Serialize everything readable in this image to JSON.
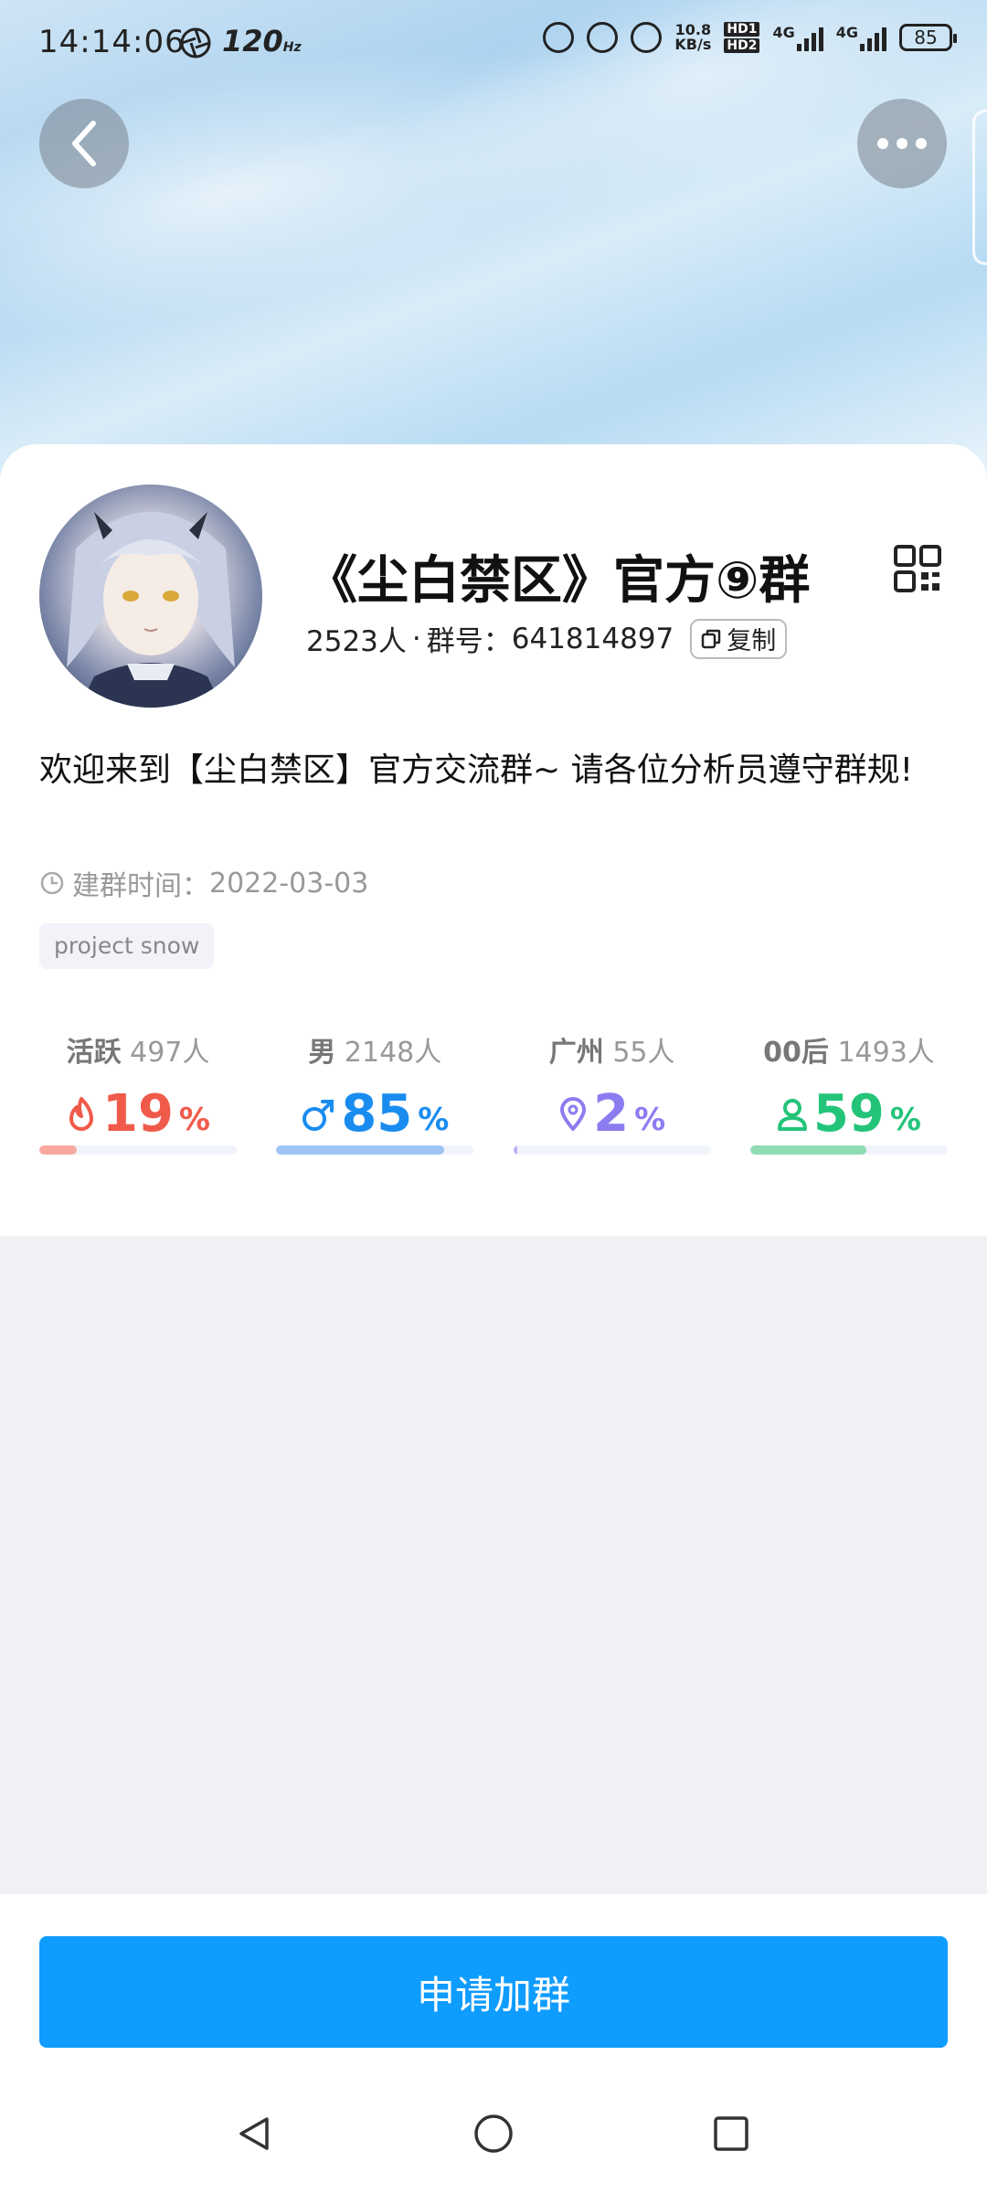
{
  "status_bar": {
    "time": "14:14:06",
    "refresh_rate": "120",
    "network_speed_value": "10.8",
    "network_speed_unit": "KB/s",
    "hd1": "HD1",
    "hd2": "HD2",
    "net1": "4G",
    "net2": "4G",
    "battery": "85"
  },
  "group": {
    "title": "《尘白禁区》官方⑨群",
    "members": "2523人",
    "separator": "·",
    "id_label": "群号：",
    "id": "641814897",
    "copy_label": "复制",
    "description": "欢迎来到【尘白禁区】官方交流群~ 请各位分析员遵守群规!",
    "created_label": "建群时间：",
    "created_date": "2022-03-03",
    "tag": "project snow"
  },
  "stats": [
    {
      "label": "活跃",
      "count": "497人",
      "percent": "19",
      "unit": "%",
      "fill": 0.19,
      "color": "#f05a4a",
      "bar_color": "#f7a99f"
    },
    {
      "label": "男",
      "count": "2148人",
      "percent": "85",
      "unit": "%",
      "fill": 0.85,
      "color": "#1a8cf0",
      "bar_color": "#9ec4f5"
    },
    {
      "label": "广州",
      "count": "55人",
      "percent": "2",
      "unit": "%",
      "fill": 0.02,
      "color": "#8b7cf0",
      "bar_color": "#b9b0f5"
    },
    {
      "label": "00后",
      "count": "1493人",
      "percent": "59",
      "unit": "%",
      "fill": 0.59,
      "color": "#23c47a",
      "bar_color": "#8fdcb5"
    }
  ],
  "icons": {
    "back": "chevron-left-icon",
    "more": "more-horizontal-icon",
    "qr": "qr-code-icon",
    "copy": "copy-icon",
    "clock": "clock-icon",
    "flame": "flame-icon",
    "male": "male-icon",
    "location": "location-pin-icon",
    "person": "person-icon"
  },
  "actions": {
    "join_label": "申请加群"
  },
  "colors": {
    "accent": "#0f9cff",
    "page_background": "#f1f1f5"
  }
}
